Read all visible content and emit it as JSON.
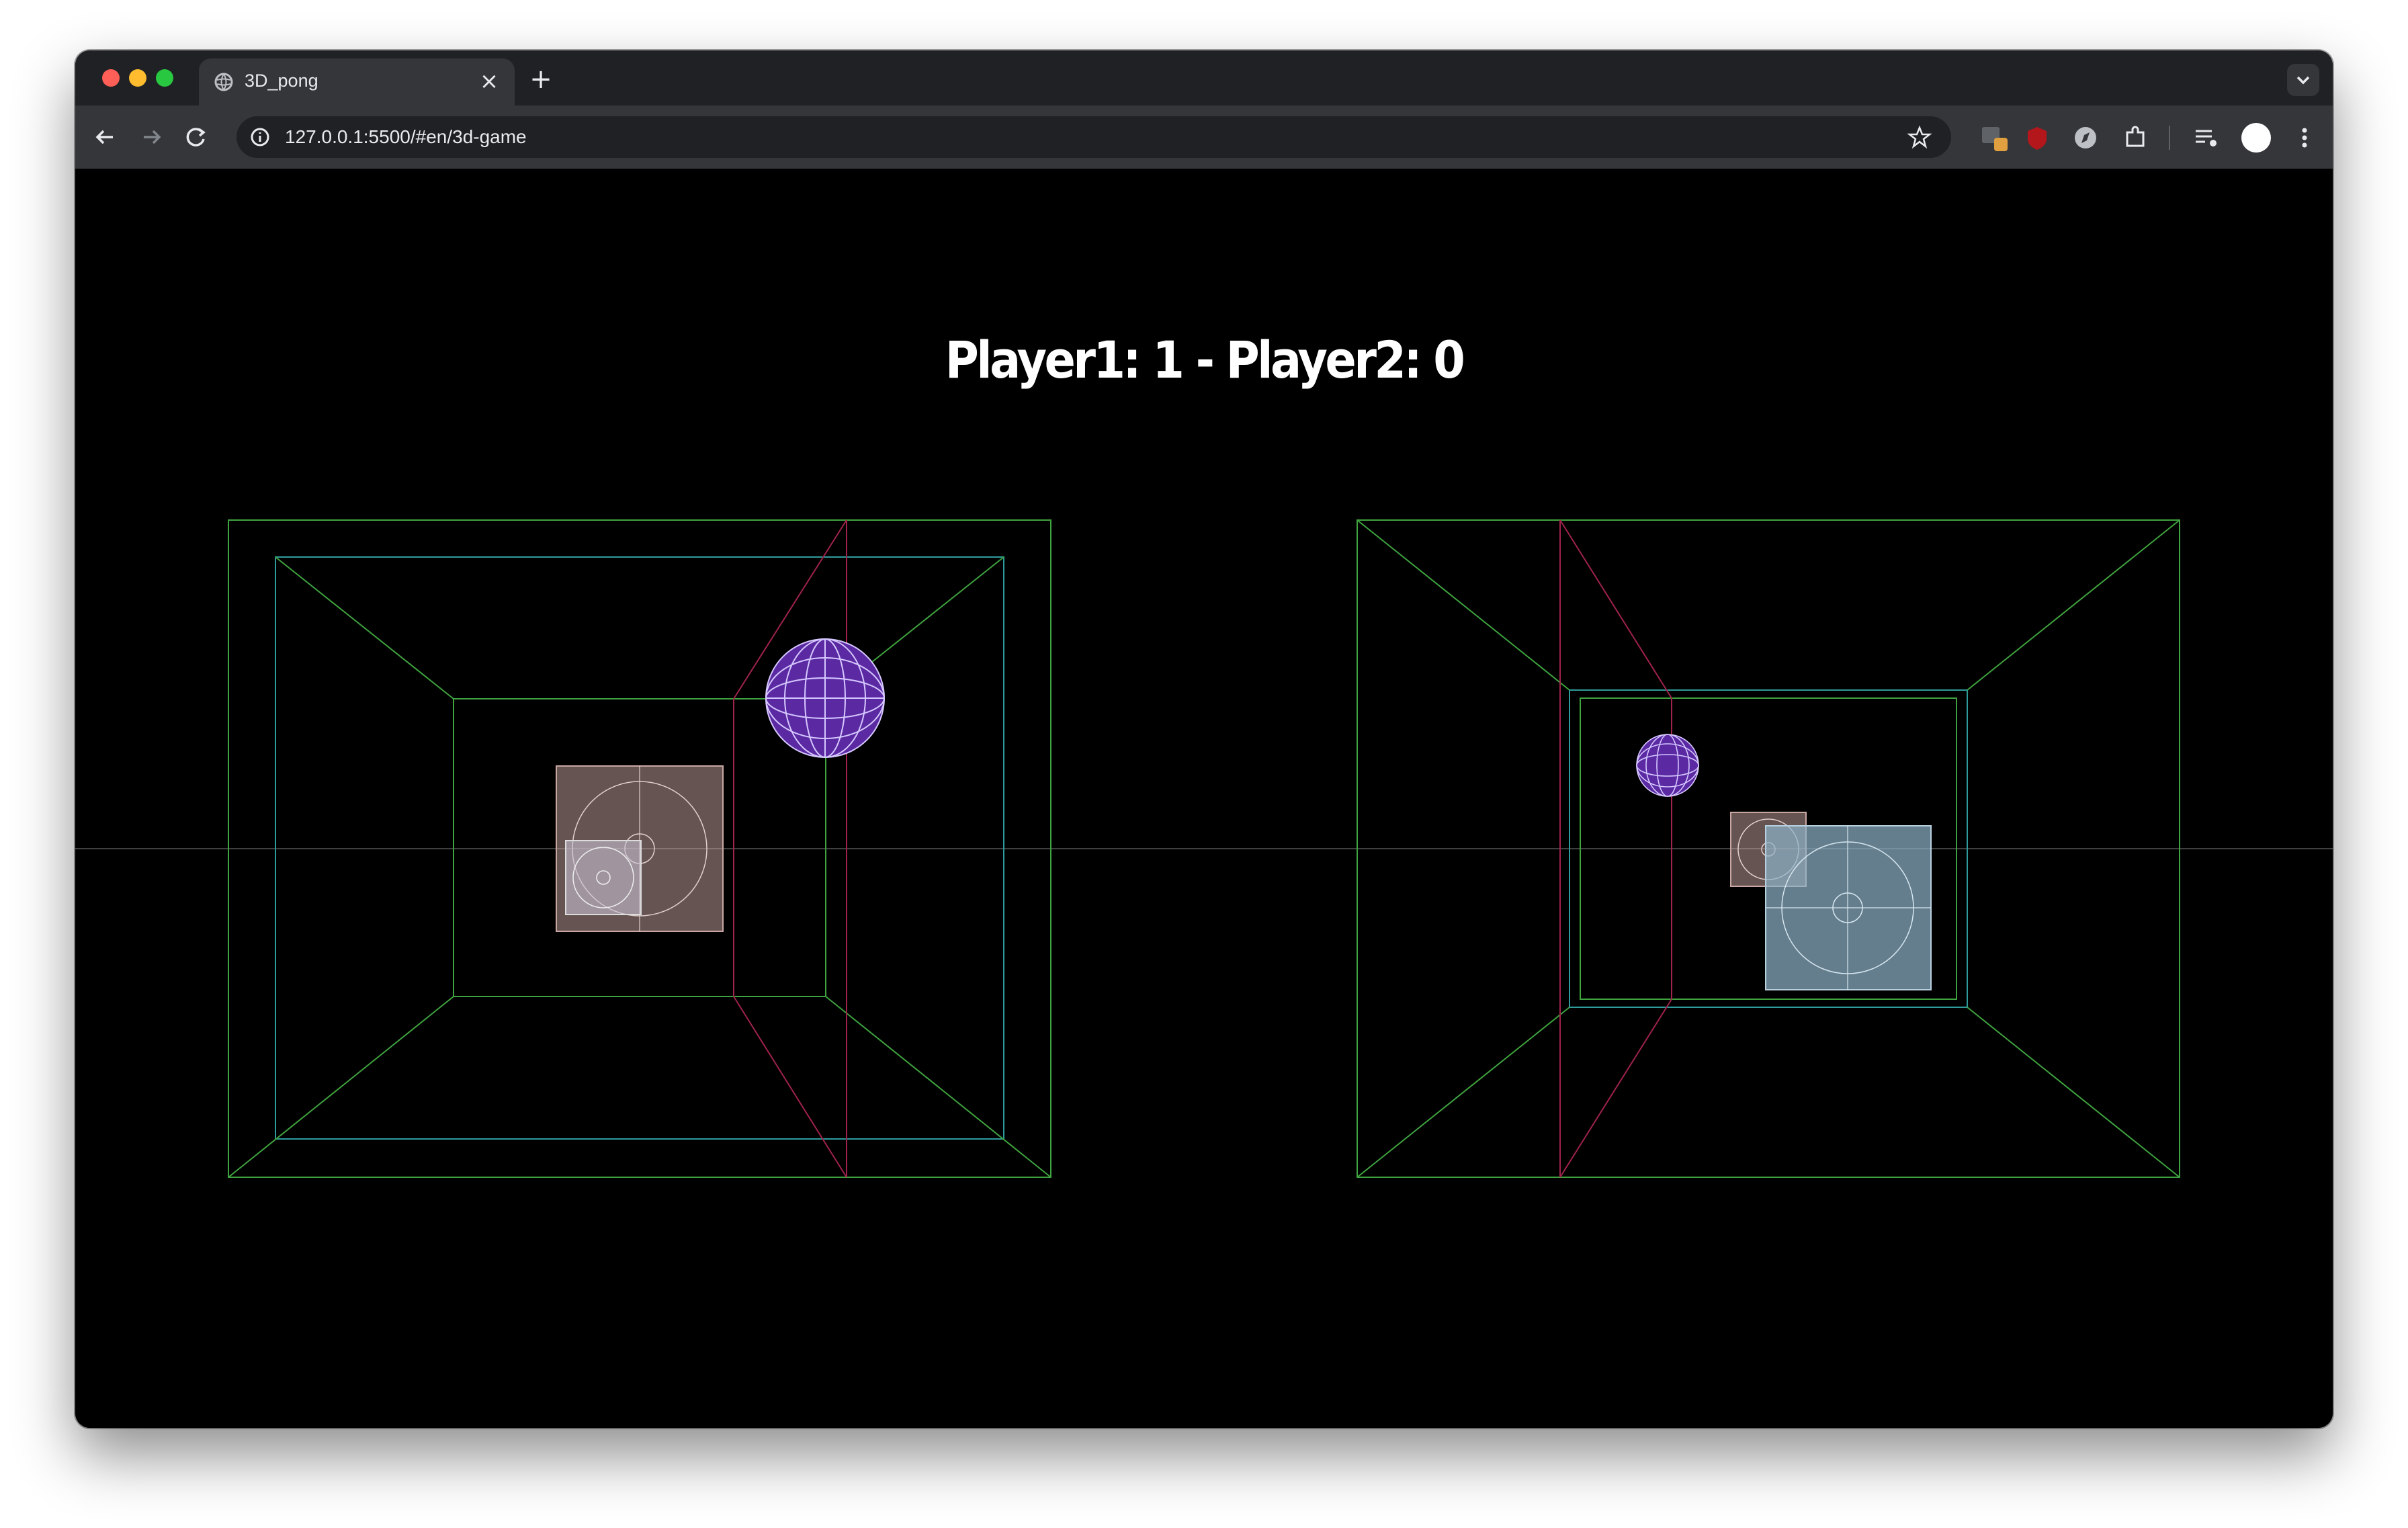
{
  "browser": {
    "tab_title": "3D_pong",
    "url": "127.0.0.1:5500/#en/3d-game"
  },
  "game": {
    "score_text": "Player1: 1 - Player2: 0"
  },
  "colors": {
    "frame_outer": "#3fa33f",
    "frame_inner": "#2f9c9c",
    "ball": "#5b2aa3",
    "paddle_player": "#c9a7a3",
    "paddle_opponent": "#8fb3c9",
    "net": "#a0234b"
  }
}
